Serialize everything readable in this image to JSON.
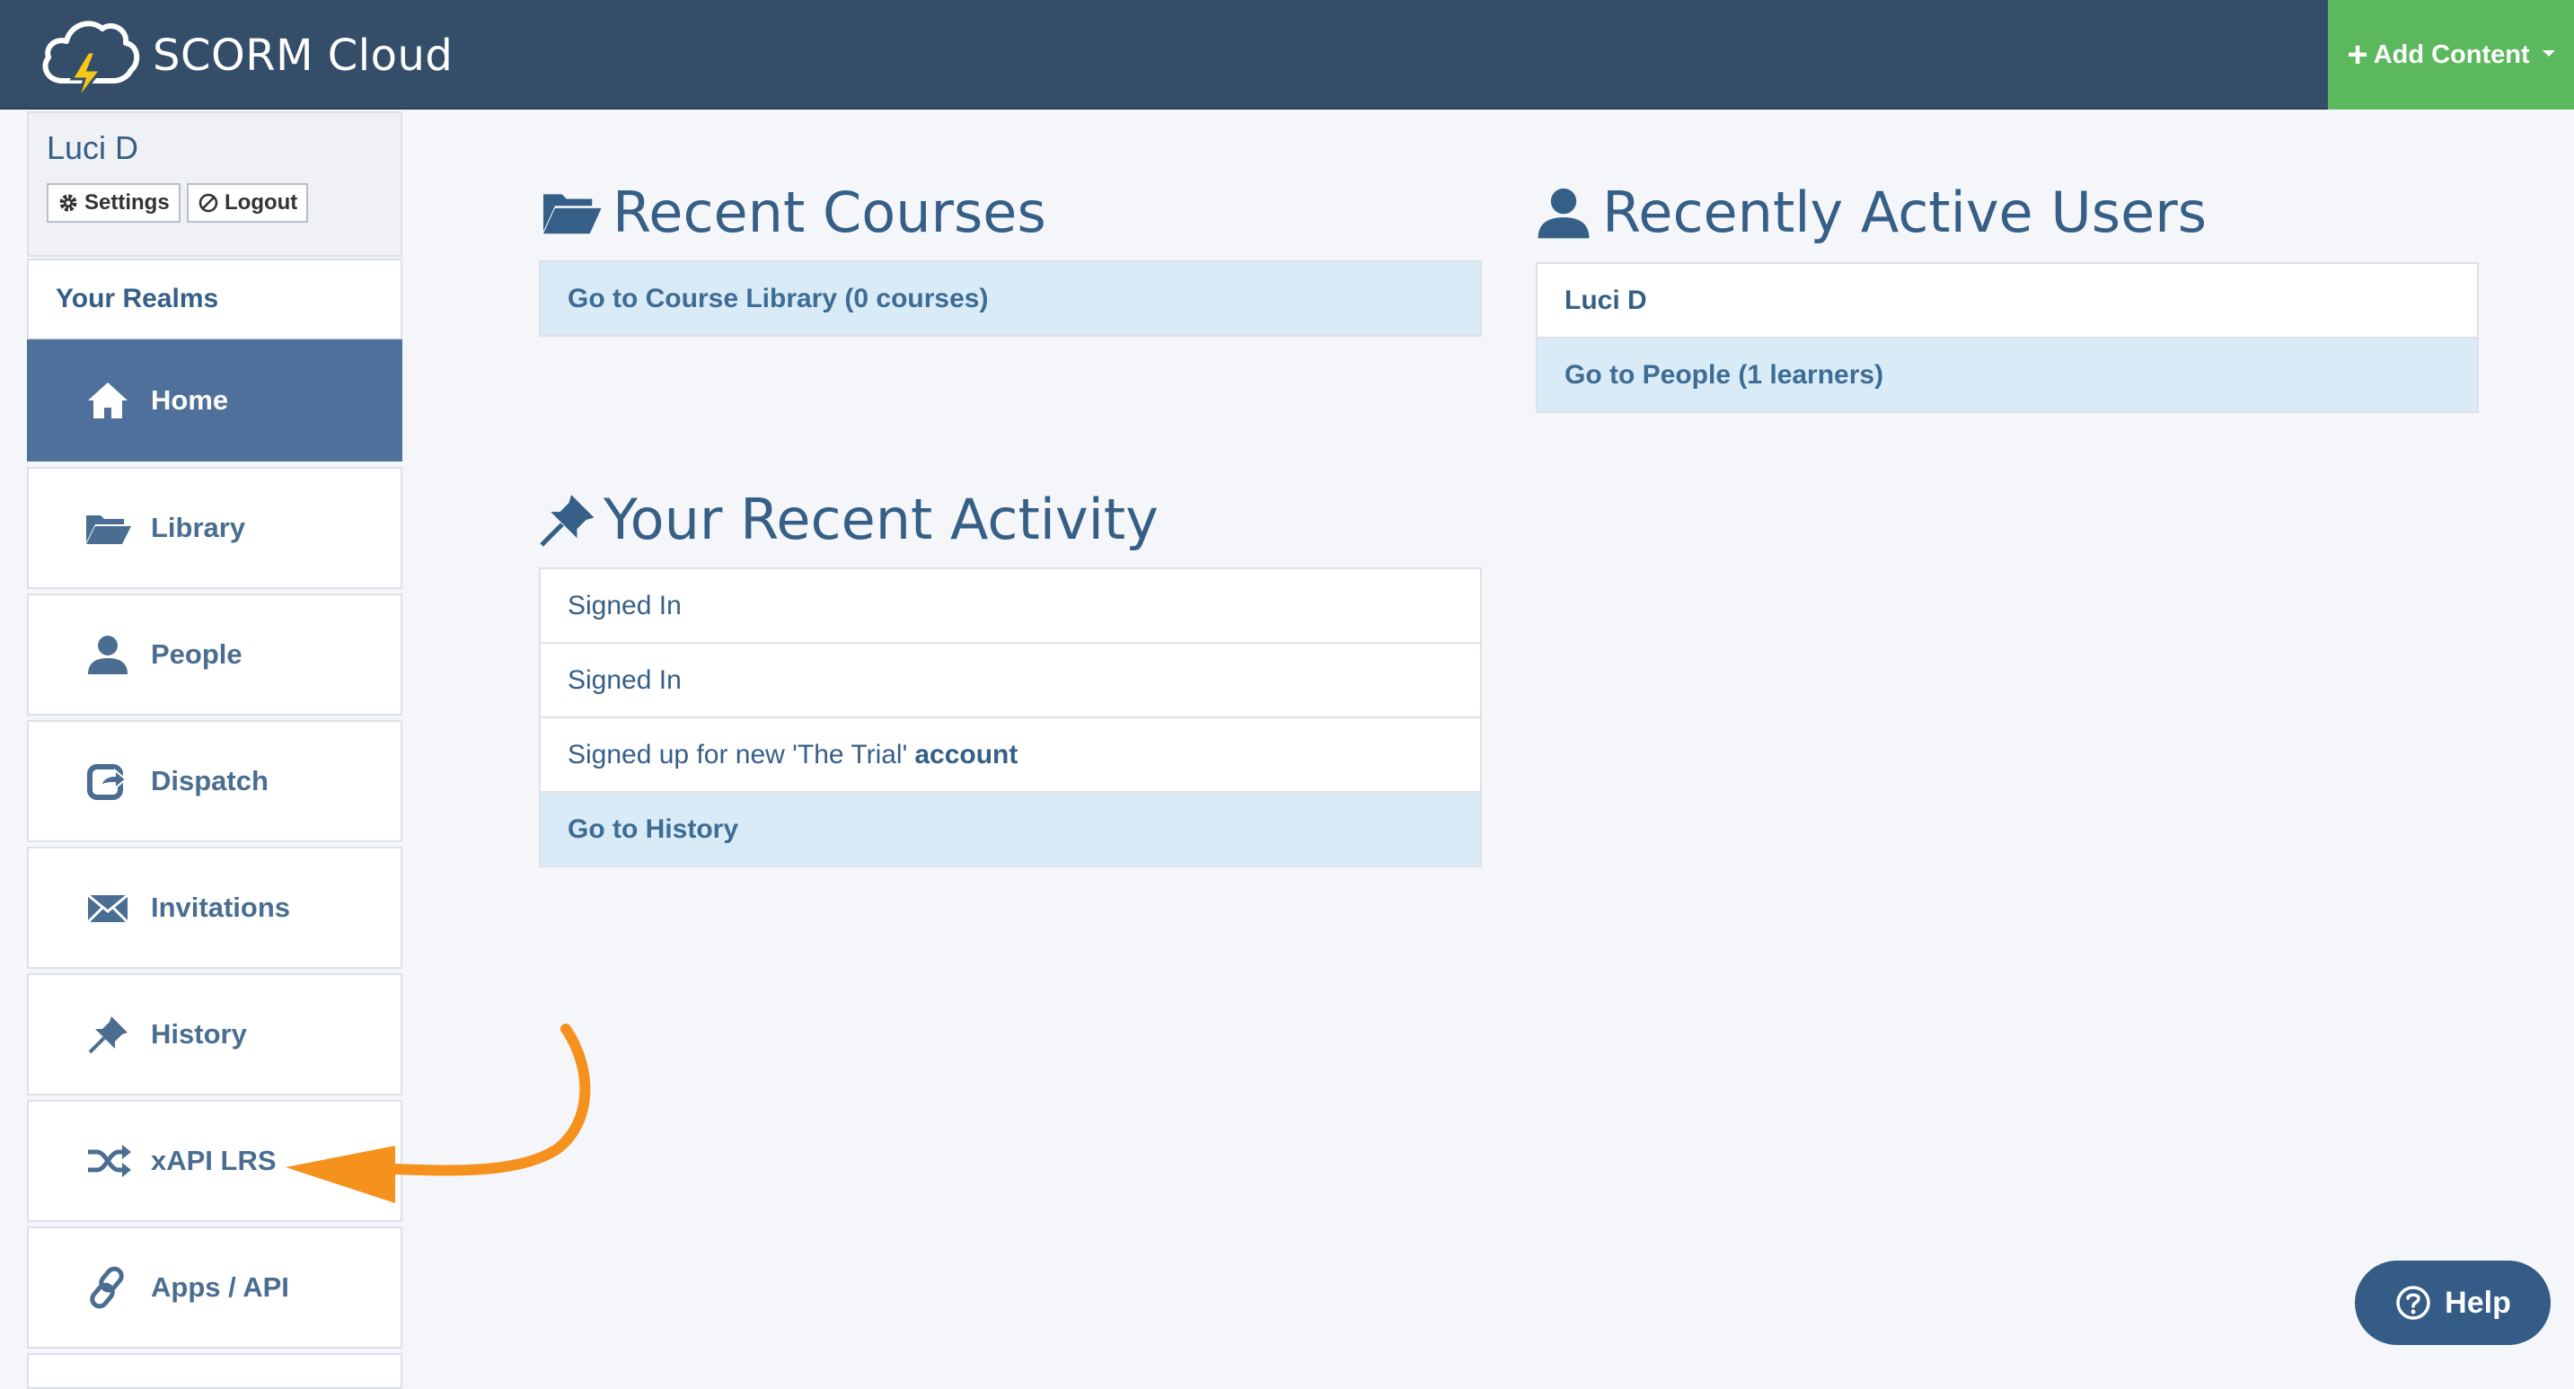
{
  "app": {
    "brand": "SCORM Cloud"
  },
  "header": {
    "add_content": "Add Content"
  },
  "user": {
    "name": "Luci D",
    "settings": "Settings",
    "logout": "Logout"
  },
  "sidebar": {
    "realms": "Your Realms",
    "items": [
      {
        "label": "Home",
        "icon": "home-icon"
      },
      {
        "label": "Library",
        "icon": "folder-open-icon"
      },
      {
        "label": "People",
        "icon": "user-icon"
      },
      {
        "label": "Dispatch",
        "icon": "share-icon"
      },
      {
        "label": "Invitations",
        "icon": "envelope-icon"
      },
      {
        "label": "History",
        "icon": "pushpin-icon"
      },
      {
        "label": "xAPI LRS",
        "icon": "shuffle-icon"
      },
      {
        "label": "Apps / API",
        "icon": "link-icon"
      }
    ]
  },
  "recent_courses": {
    "title": "Recent Courses",
    "link": "Go to Course Library (0 courses)"
  },
  "recent_users": {
    "title": "Recently Active Users",
    "user": "Luci D",
    "link": "Go to People (1 learners)"
  },
  "recent_activity": {
    "title": "Your Recent Activity",
    "items": [
      "Signed In",
      "Signed In"
    ],
    "signup_prefix": "Signed up for new 'The Trial'",
    "signup_suffix": "account",
    "link": "Go to History"
  },
  "help": {
    "label": "Help"
  },
  "colors": {
    "header": "#344e69",
    "accent_green": "#5cb85c",
    "active_nav": "#4e709a",
    "annotation_arrow": "#f5921e"
  }
}
